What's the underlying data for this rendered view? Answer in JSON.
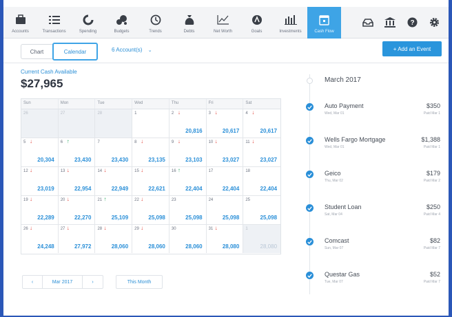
{
  "nav": {
    "items": [
      {
        "label": "Accounts",
        "icon": "briefcase-icon"
      },
      {
        "label": "Transactions",
        "icon": "list-icon"
      },
      {
        "label": "Spending",
        "icon": "pie-chart-icon"
      },
      {
        "label": "Budgets",
        "icon": "coins-icon"
      },
      {
        "label": "Trends",
        "icon": "clock-icon"
      },
      {
        "label": "Debts",
        "icon": "money-bag-icon"
      },
      {
        "label": "Net Worth",
        "icon": "line-chart-icon"
      },
      {
        "label": "Goals",
        "icon": "target-icon"
      },
      {
        "label": "Investments",
        "icon": "bar-chart-icon"
      },
      {
        "label": "Cash Flow",
        "icon": "calendar-icon"
      }
    ],
    "active_index": 9,
    "right_icons": [
      "inbox-icon",
      "bank-icon",
      "help-icon",
      "gear-icon"
    ]
  },
  "toolbar": {
    "chart_label": "Chart",
    "calendar_label": "Calendar",
    "accounts_label": "6 Account(s)",
    "add_event_label": "+ Add an Event"
  },
  "cash": {
    "label": "Current Cash Available",
    "value": "$27,965"
  },
  "calendar": {
    "weekdays": [
      "Sun",
      "Mon",
      "Tue",
      "Wed",
      "Thu",
      "Fri",
      "Sat"
    ],
    "weeks": [
      [
        {
          "day": "26",
          "muted": true,
          "balance": "",
          "arrow": ""
        },
        {
          "day": "27",
          "muted": true,
          "balance": "",
          "arrow": ""
        },
        {
          "day": "28",
          "muted": true,
          "balance": "",
          "arrow": ""
        },
        {
          "day": "1",
          "muted": false,
          "balance": "",
          "arrow": ""
        },
        {
          "day": "2",
          "muted": false,
          "balance": "20,816",
          "arrow": "down"
        },
        {
          "day": "3",
          "muted": false,
          "balance": "20,617",
          "arrow": "down"
        },
        {
          "day": "4",
          "muted": false,
          "balance": "20,617",
          "arrow": "down"
        }
      ],
      [
        {
          "day": "5",
          "muted": false,
          "balance": "20,304",
          "arrow": "down"
        },
        {
          "day": "6",
          "muted": false,
          "balance": "23,430",
          "arrow": "up"
        },
        {
          "day": "7",
          "muted": false,
          "balance": "23,430",
          "arrow": ""
        },
        {
          "day": "8",
          "muted": false,
          "balance": "23,135",
          "arrow": "down"
        },
        {
          "day": "9",
          "muted": false,
          "balance": "23,103",
          "arrow": "down"
        },
        {
          "day": "10",
          "muted": false,
          "balance": "23,027",
          "arrow": "down"
        },
        {
          "day": "11",
          "muted": false,
          "balance": "23,027",
          "arrow": "down"
        }
      ],
      [
        {
          "day": "12",
          "muted": false,
          "balance": "23,019",
          "arrow": "down"
        },
        {
          "day": "13",
          "muted": false,
          "balance": "22,954",
          "arrow": "down"
        },
        {
          "day": "14",
          "muted": false,
          "balance": "22,949",
          "arrow": "down"
        },
        {
          "day": "15",
          "muted": false,
          "balance": "22,621",
          "arrow": "down"
        },
        {
          "day": "16",
          "muted": false,
          "balance": "22,404",
          "arrow": "up"
        },
        {
          "day": "17",
          "muted": false,
          "balance": "22,404",
          "arrow": ""
        },
        {
          "day": "18",
          "muted": false,
          "balance": "22,404",
          "arrow": ""
        }
      ],
      [
        {
          "day": "19",
          "muted": false,
          "balance": "22,289",
          "arrow": "down"
        },
        {
          "day": "20",
          "muted": false,
          "balance": "22,270",
          "arrow": "down"
        },
        {
          "day": "21",
          "muted": false,
          "balance": "25,109",
          "arrow": "up"
        },
        {
          "day": "22",
          "muted": false,
          "balance": "25,098",
          "arrow": "down"
        },
        {
          "day": "23",
          "muted": false,
          "balance": "25,098",
          "arrow": ""
        },
        {
          "day": "24",
          "muted": false,
          "balance": "25,098",
          "arrow": ""
        },
        {
          "day": "25",
          "muted": false,
          "balance": "25,098",
          "arrow": ""
        }
      ],
      [
        {
          "day": "26",
          "muted": false,
          "balance": "24,248",
          "arrow": "down"
        },
        {
          "day": "27",
          "muted": false,
          "balance": "27,972",
          "arrow": "down"
        },
        {
          "day": "28",
          "muted": false,
          "balance": "28,060",
          "arrow": "down"
        },
        {
          "day": "29",
          "muted": false,
          "balance": "28,060",
          "arrow": "down"
        },
        {
          "day": "30",
          "muted": false,
          "balance": "28,060",
          "arrow": ""
        },
        {
          "day": "31",
          "muted": false,
          "balance": "28,080",
          "arrow": "down"
        },
        {
          "day": "1",
          "muted": true,
          "balance": "28,080",
          "arrow": ""
        }
      ]
    ]
  },
  "pager": {
    "prev_label": "‹",
    "month_label": "Mar 2017",
    "next_label": "›",
    "this_month_label": "This Month"
  },
  "timeline": {
    "month": "March 2017",
    "items": [
      {
        "name": "Auto Payment",
        "date": "Wed, Mar 01",
        "amount": "$350",
        "status": "Paid Mar 1"
      },
      {
        "name": "Wells Fargo Mortgage",
        "date": "Wed, Mar 01",
        "amount": "$1,388",
        "status": "Paid Mar 1"
      },
      {
        "name": "Geico",
        "date": "Thu, Mar 02",
        "amount": "$179",
        "status": "Paid Mar 2"
      },
      {
        "name": "Student Loan",
        "date": "Sat, Mar 04",
        "amount": "$250",
        "status": "Paid Mar 4"
      },
      {
        "name": "Comcast",
        "date": "Sun, Mar 07",
        "amount": "$82",
        "status": "Paid Mar 7"
      },
      {
        "name": "Questar Gas",
        "date": "Tue, Mar 07",
        "amount": "$52",
        "status": "Paid Mar 7"
      }
    ]
  },
  "colors": {
    "accent": "#2a8fd8",
    "active_tab": "#3ea4e6",
    "down_arrow": "#e2453b",
    "up_arrow": "#2ea862",
    "frame": "#2b57b8"
  }
}
